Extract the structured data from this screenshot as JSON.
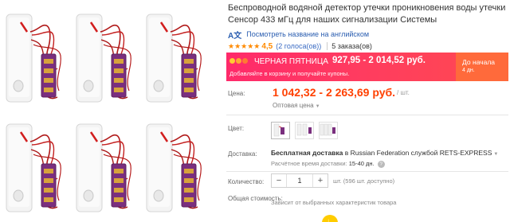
{
  "product": {
    "title": "Беспроводной водяной детектор утечки проникновения воды утечки Сенсор 433 мГц для наших сигнализации Системы",
    "translate_link": "Посмотреть название на английском",
    "rating": "4,5",
    "votes": "(2 голоса(ов))",
    "orders": "5 заказа(ов)"
  },
  "promo": {
    "title": "ЧЕРНАЯ ПЯТНИЦА",
    "price": "927,95 - 2 014,52 руб.",
    "subtitle": "Добавляйте в корзину и получайте купоны.",
    "cta_title": "До начала",
    "cta_sub": "4 дн."
  },
  "price": {
    "label": "Цена:",
    "value": "1 042,32 - 2 263,69 руб.",
    "unit": "/ шт.",
    "wholesale": "Оптовая цена"
  },
  "color": {
    "label": "Цвет:"
  },
  "shipping": {
    "label": "Доставка:",
    "free": "Бесплатная доставка",
    "rest": " в Russian Federation службой RETS-EXPRESS",
    "time_label": "Расчётное время доставки:",
    "time_value": "15-40 дн."
  },
  "quantity": {
    "label": "Количество:",
    "minus": "−",
    "value": "1",
    "plus": "+",
    "note": "шт. (596 шт. доступно)"
  },
  "total": {
    "label": "Общая стоимость:",
    "value": "Зависит от выбранных характеристик товара"
  },
  "colors": {
    "accent": "#ff4000",
    "promo": "#ff3b60",
    "link": "#2a5db0",
    "star": "#ff8a00"
  }
}
